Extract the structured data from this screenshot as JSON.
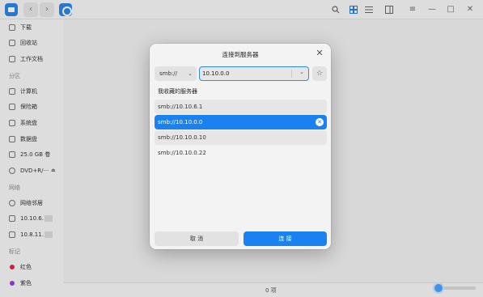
{
  "window": {
    "nav_back": "‹",
    "nav_forward": "›"
  },
  "toolbar": {
    "search_icon": "search-icon",
    "icon_view": "grid-icon",
    "list_view": "list-icon",
    "detail_view": "panel-icon",
    "menu": "≡",
    "minimize": "—",
    "maximize": "□",
    "close": "✕"
  },
  "sidebar": {
    "items_top": [
      {
        "label": "下载",
        "icon": "download-icon"
      },
      {
        "label": "回收站",
        "icon": "trash-icon"
      },
      {
        "label": "工作文档",
        "icon": "folder-icon"
      }
    ],
    "partition_header": "分区",
    "partitions": [
      {
        "label": "计算机",
        "icon": "computer-icon"
      },
      {
        "label": "保险箱",
        "icon": "vault-icon"
      },
      {
        "label": "系统盘",
        "icon": "disk-icon"
      },
      {
        "label": "数据盘",
        "icon": "disk-icon"
      },
      {
        "label": "25.0 GB 卷",
        "icon": "disk-icon"
      },
      {
        "label": "DVD+R/···",
        "icon": "dvd-icon"
      }
    ],
    "eject": "⏏",
    "network_header": "网络",
    "network": [
      {
        "label": "网络邻居",
        "icon": "network-icon"
      },
      {
        "label": "10.10.6.",
        "icon": "share-icon"
      },
      {
        "label": "10.8.11.",
        "icon": "share-icon"
      }
    ],
    "tags_header": "标记",
    "tags": [
      {
        "label": "红色",
        "color": "#e0284a"
      },
      {
        "label": "紫色",
        "color": "#a03ad8"
      }
    ]
  },
  "status": {
    "item_count": "0 项"
  },
  "dialog": {
    "title": "连接到服务器",
    "close": "✕",
    "protocol": "smb://",
    "protocol_chevron": "⌄",
    "address_value": "10.10.0.0",
    "address_chevron": "⌄",
    "favorite_button": "☆",
    "favorites_header": "我收藏的服务器",
    "favorites": [
      {
        "label": "smb://10.10.6.1"
      },
      {
        "label": "smb://10.10.0.0",
        "selected": true
      },
      {
        "label": "smb://10.10.0.10"
      },
      {
        "label": "smb://10.10.0.22"
      }
    ],
    "delete_icon": "✕",
    "cancel_label": "取 消",
    "connect_label": "连 接"
  },
  "colors": {
    "accent": "#1a82f0",
    "tag_red": "#e0284a",
    "tag_purple": "#a03ad8"
  }
}
